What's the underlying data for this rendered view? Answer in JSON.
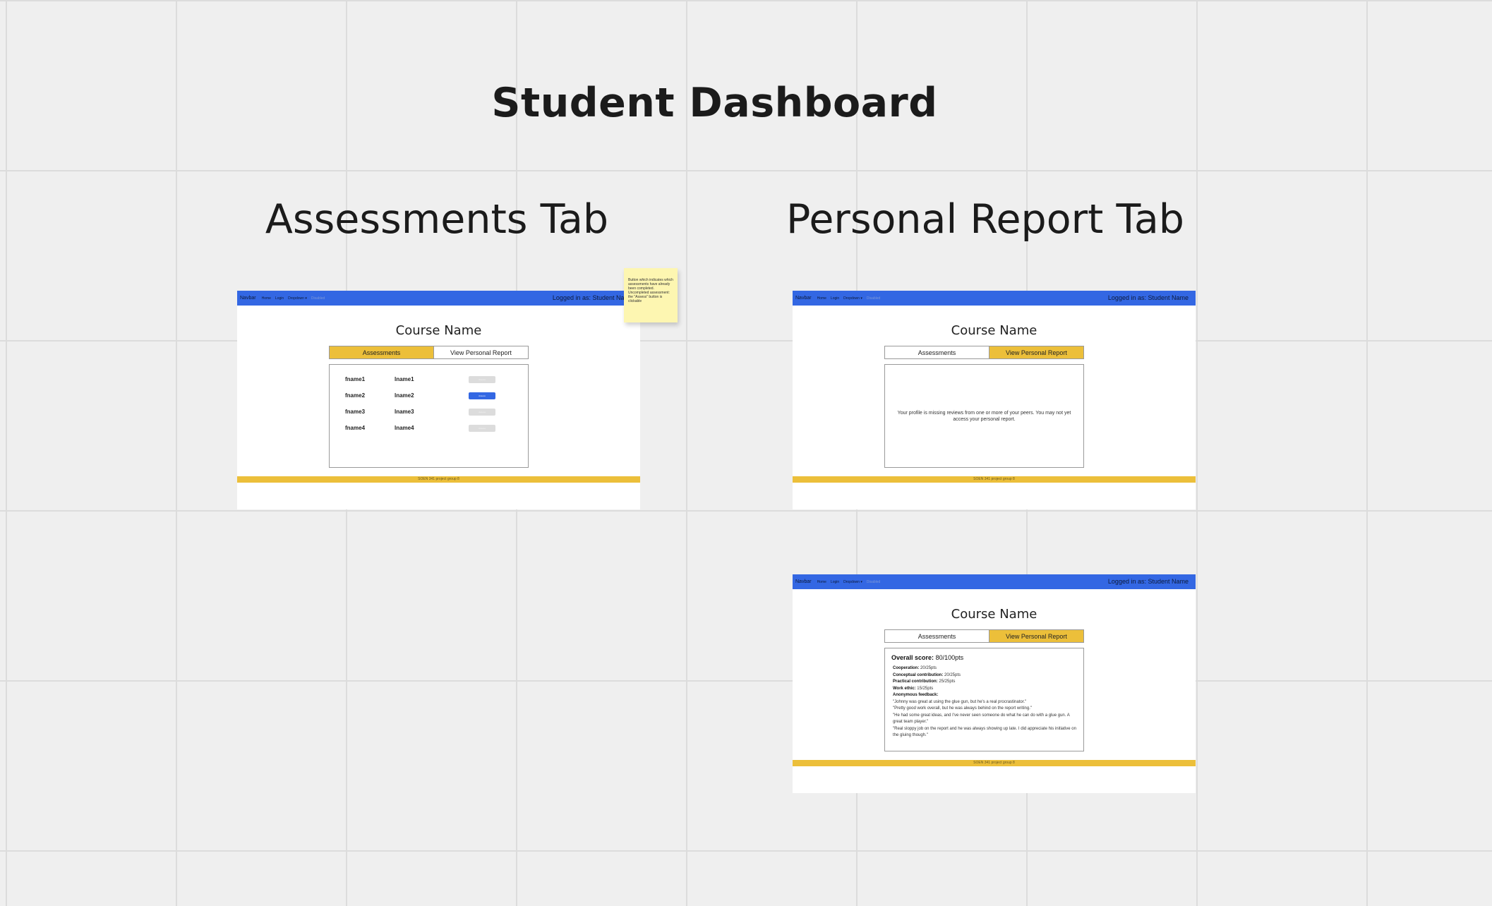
{
  "board": {
    "title": "Student Dashboard",
    "sections": [
      "Assessments Tab",
      "Personal Report Tab"
    ]
  },
  "mock": {
    "nav": {
      "brand": "Navbar",
      "home": "Home",
      "login": "Login",
      "dropdown": "Dropdown ▾",
      "disabled": "Disabled",
      "user": "Logged in as: Student Name"
    },
    "course_name": "Course Name",
    "tabs": {
      "assessments": "Assessments",
      "report": "View Personal Report"
    },
    "footer": "SOEN 341 project group 8"
  },
  "assessments": {
    "rows": [
      {
        "fname": "fname1",
        "lname": "lname1",
        "button": "Assess",
        "enabled": false
      },
      {
        "fname": "fname2",
        "lname": "lname2",
        "button": "Assess",
        "enabled": true
      },
      {
        "fname": "fname3",
        "lname": "lname3",
        "button": "Assess",
        "enabled": false
      },
      {
        "fname": "fname4",
        "lname": "lname4",
        "button": "Assess",
        "enabled": false
      }
    ]
  },
  "sticky_note": "Button which indicates which assessments have already been completed. Uncompleted assessment: the \"Assess\" button is clickable",
  "report_missing": {
    "message": "Your profile is missing reviews from one or more of your peers. You may not yet access your personal report."
  },
  "report": {
    "overall_label": "Overall score:",
    "overall_value": "80/100pts",
    "items": [
      {
        "label": "Cooperation:",
        "value": "20/25pts"
      },
      {
        "label": "Conceptual contribution:",
        "value": "20/25pts"
      },
      {
        "label": "Practical contribution:",
        "value": "25/25pts"
      },
      {
        "label": "Work ethic:",
        "value": "15/25pts"
      }
    ],
    "feedback_label": "Anonymous feedback:",
    "feedback": [
      "\"Johnny was great at using the glue gun, but he's a real procrastinator.\"",
      "\"Pretty good work overall, but he was always behind on the report writing.\"",
      "\"He had some great ideas, and I've never seen someone do what he can do with a glue gun. A great team player.\"",
      "\"Real sloppy job on the report and he was always showing up late. I did appreciate his initiative on the gluing though.\""
    ]
  }
}
